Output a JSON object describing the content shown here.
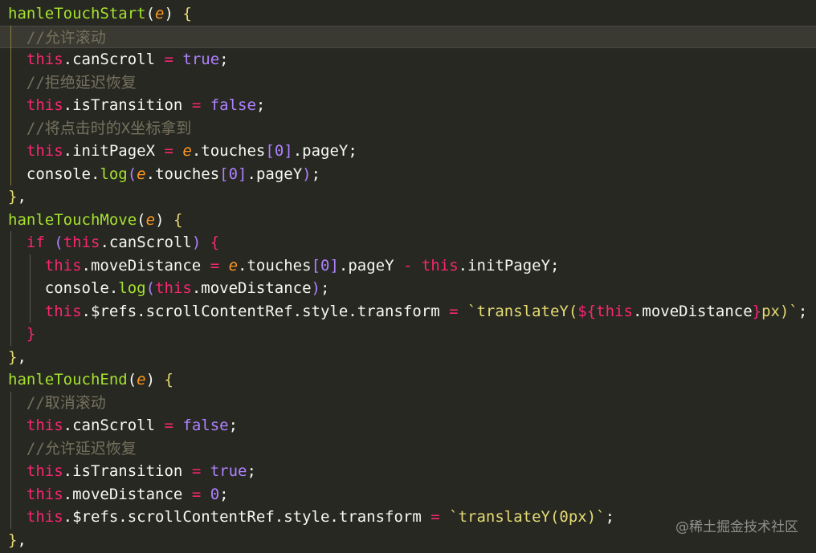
{
  "editor": {
    "lines": [
      [
        {
          "t": "hanleTouchStart",
          "c": "fn"
        },
        {
          "t": "(",
          "c": "punc"
        },
        {
          "t": "e",
          "c": "param"
        },
        {
          "t": ")",
          "c": "punc"
        },
        {
          "t": " ",
          "c": "punc"
        },
        {
          "t": "{",
          "c": "brace1"
        }
      ],
      [
        {
          "t": "  //允许滚动",
          "c": "cmt"
        }
      ],
      [
        {
          "t": "  ",
          "c": "punc"
        },
        {
          "t": "this",
          "c": "kw"
        },
        {
          "t": ".canScroll ",
          "c": "prop"
        },
        {
          "t": "=",
          "c": "op"
        },
        {
          "t": " ",
          "c": "punc"
        },
        {
          "t": "true",
          "c": "bool"
        },
        {
          "t": ";",
          "c": "punc"
        }
      ],
      [
        {
          "t": "  //拒绝延迟恢复",
          "c": "cmt"
        }
      ],
      [
        {
          "t": "  ",
          "c": "punc"
        },
        {
          "t": "this",
          "c": "kw"
        },
        {
          "t": ".isTransition ",
          "c": "prop"
        },
        {
          "t": "=",
          "c": "op"
        },
        {
          "t": " ",
          "c": "punc"
        },
        {
          "t": "false",
          "c": "bool"
        },
        {
          "t": ";",
          "c": "punc"
        }
      ],
      [
        {
          "t": "  //将点击时的X坐标拿到",
          "c": "cmt"
        }
      ],
      [
        {
          "t": "  ",
          "c": "punc"
        },
        {
          "t": "this",
          "c": "kw"
        },
        {
          "t": ".initPageX ",
          "c": "prop"
        },
        {
          "t": "=",
          "c": "op"
        },
        {
          "t": " ",
          "c": "punc"
        },
        {
          "t": "e",
          "c": "param"
        },
        {
          "t": ".touches",
          "c": "prop"
        },
        {
          "t": "[",
          "c": "sq"
        },
        {
          "t": "0",
          "c": "num"
        },
        {
          "t": "]",
          "c": "sq"
        },
        {
          "t": ".pageY;",
          "c": "prop"
        }
      ],
      [
        {
          "t": "  console.",
          "c": "prop"
        },
        {
          "t": "log",
          "c": "fn"
        },
        {
          "t": "(",
          "c": "sq"
        },
        {
          "t": "e",
          "c": "param"
        },
        {
          "t": ".touches",
          "c": "prop"
        },
        {
          "t": "[",
          "c": "sq"
        },
        {
          "t": "0",
          "c": "num"
        },
        {
          "t": "]",
          "c": "sq"
        },
        {
          "t": ".pageY",
          "c": "prop"
        },
        {
          "t": ")",
          "c": "sq"
        },
        {
          "t": ";",
          "c": "punc"
        }
      ],
      [
        {
          "t": "}",
          "c": "brace1"
        },
        {
          "t": ",",
          "c": "punc"
        }
      ],
      [
        {
          "t": "hanleTouchMove",
          "c": "fn"
        },
        {
          "t": "(",
          "c": "punc"
        },
        {
          "t": "e",
          "c": "param"
        },
        {
          "t": ")",
          "c": "punc"
        },
        {
          "t": " ",
          "c": "punc"
        },
        {
          "t": "{",
          "c": "brace1"
        }
      ],
      [
        {
          "t": "  ",
          "c": "punc"
        },
        {
          "t": "if",
          "c": "kw"
        },
        {
          "t": " ",
          "c": "punc"
        },
        {
          "t": "(",
          "c": "sq"
        },
        {
          "t": "this",
          "c": "kw"
        },
        {
          "t": ".canScroll",
          "c": "prop"
        },
        {
          "t": ")",
          "c": "sq"
        },
        {
          "t": " ",
          "c": "punc"
        },
        {
          "t": "{",
          "c": "kw"
        }
      ],
      [
        {
          "t": "    ",
          "c": "punc"
        },
        {
          "t": "this",
          "c": "kw"
        },
        {
          "t": ".moveDistance ",
          "c": "prop"
        },
        {
          "t": "=",
          "c": "op"
        },
        {
          "t": " ",
          "c": "punc"
        },
        {
          "t": "e",
          "c": "param"
        },
        {
          "t": ".touches",
          "c": "prop"
        },
        {
          "t": "[",
          "c": "sq"
        },
        {
          "t": "0",
          "c": "num"
        },
        {
          "t": "]",
          "c": "sq"
        },
        {
          "t": ".pageY ",
          "c": "prop"
        },
        {
          "t": "-",
          "c": "op"
        },
        {
          "t": " ",
          "c": "punc"
        },
        {
          "t": "this",
          "c": "kw"
        },
        {
          "t": ".initPageY;",
          "c": "prop"
        }
      ],
      [
        {
          "t": "    console.",
          "c": "prop"
        },
        {
          "t": "log",
          "c": "fn"
        },
        {
          "t": "(",
          "c": "sq"
        },
        {
          "t": "this",
          "c": "kw"
        },
        {
          "t": ".moveDistance",
          "c": "prop"
        },
        {
          "t": ")",
          "c": "sq"
        },
        {
          "t": ";",
          "c": "punc"
        }
      ],
      [
        {
          "t": "    ",
          "c": "punc"
        },
        {
          "t": "this",
          "c": "kw"
        },
        {
          "t": ".$refs.scrollContentRef.style.transform ",
          "c": "prop"
        },
        {
          "t": "=",
          "c": "op"
        },
        {
          "t": " ",
          "c": "punc"
        },
        {
          "t": "`translateY(",
          "c": "str"
        },
        {
          "t": "${",
          "c": "kw"
        },
        {
          "t": "this",
          "c": "kw"
        },
        {
          "t": ".moveDistance",
          "c": "prop"
        },
        {
          "t": "}",
          "c": "kw"
        },
        {
          "t": "px)`",
          "c": "str"
        },
        {
          "t": ";",
          "c": "punc"
        }
      ],
      [
        {
          "t": "  ",
          "c": "punc"
        },
        {
          "t": "}",
          "c": "kw"
        }
      ],
      [
        {
          "t": "}",
          "c": "brace1"
        },
        {
          "t": ",",
          "c": "punc"
        }
      ],
      [
        {
          "t": "hanleTouchEnd",
          "c": "fn"
        },
        {
          "t": "(",
          "c": "punc"
        },
        {
          "t": "e",
          "c": "param"
        },
        {
          "t": ")",
          "c": "punc"
        },
        {
          "t": " ",
          "c": "punc"
        },
        {
          "t": "{",
          "c": "brace1"
        }
      ],
      [
        {
          "t": "  //取消滚动",
          "c": "cmt"
        }
      ],
      [
        {
          "t": "  ",
          "c": "punc"
        },
        {
          "t": "this",
          "c": "kw"
        },
        {
          "t": ".canScroll ",
          "c": "prop"
        },
        {
          "t": "=",
          "c": "op"
        },
        {
          "t": " ",
          "c": "punc"
        },
        {
          "t": "false",
          "c": "bool"
        },
        {
          "t": ";",
          "c": "punc"
        }
      ],
      [
        {
          "t": "  //允许延迟恢复",
          "c": "cmt"
        }
      ],
      [
        {
          "t": "  ",
          "c": "punc"
        },
        {
          "t": "this",
          "c": "kw"
        },
        {
          "t": ".isTransition ",
          "c": "prop"
        },
        {
          "t": "=",
          "c": "op"
        },
        {
          "t": " ",
          "c": "punc"
        },
        {
          "t": "true",
          "c": "bool"
        },
        {
          "t": ";",
          "c": "punc"
        }
      ],
      [
        {
          "t": "  ",
          "c": "punc"
        },
        {
          "t": "this",
          "c": "kw"
        },
        {
          "t": ".moveDistance ",
          "c": "prop"
        },
        {
          "t": "=",
          "c": "op"
        },
        {
          "t": " ",
          "c": "punc"
        },
        {
          "t": "0",
          "c": "num"
        },
        {
          "t": ";",
          "c": "punc"
        }
      ],
      [
        {
          "t": "  ",
          "c": "punc"
        },
        {
          "t": "this",
          "c": "kw"
        },
        {
          "t": ".$refs.scrollContentRef.style.transform ",
          "c": "prop"
        },
        {
          "t": "=",
          "c": "op"
        },
        {
          "t": " ",
          "c": "punc"
        },
        {
          "t": "`translateY(0px)`",
          "c": "str"
        },
        {
          "t": ";",
          "c": "punc"
        }
      ],
      [
        {
          "t": "}",
          "c": "brace1"
        },
        {
          "t": ",",
          "c": "punc"
        }
      ]
    ],
    "active_line": 2
  },
  "colors": {
    "background": "#272822",
    "function": "#a6e22e",
    "keyword": "#f92672",
    "parameter": "#fd971f",
    "constant": "#ae81ff",
    "string": "#e6db74",
    "comment": "#75715e",
    "text": "#f8f8f2"
  },
  "watermark": {
    "text": "@稀土掘金技术社区"
  }
}
